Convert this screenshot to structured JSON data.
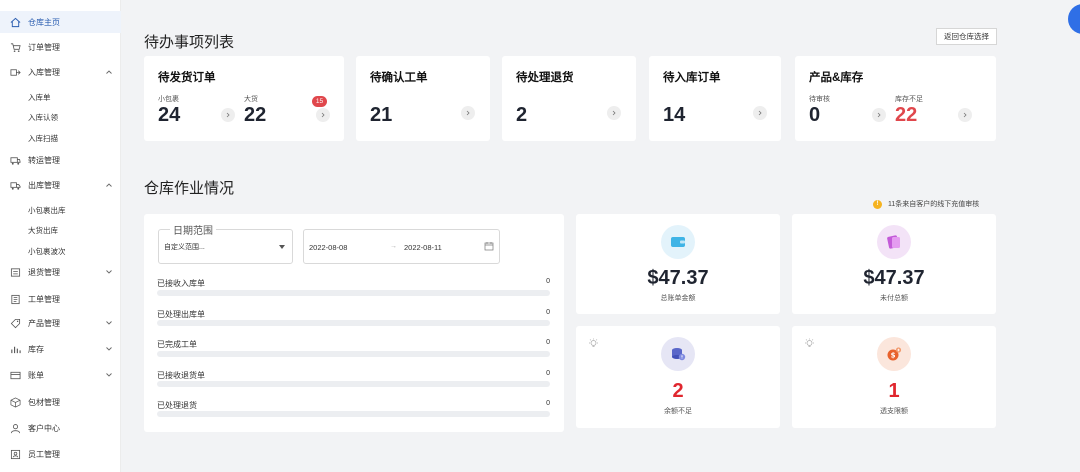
{
  "sidebar": {
    "items": [
      {
        "label": "仓库主页",
        "icon": "home-icon",
        "active": true
      },
      {
        "label": "订单管理",
        "icon": "cart-icon"
      },
      {
        "label": "入库管理",
        "icon": "inbound-icon",
        "expanded": true,
        "children": [
          "入库单",
          "入库认领",
          "入库扫描"
        ]
      },
      {
        "label": "转运管理",
        "icon": "transfer-icon"
      },
      {
        "label": "出库管理",
        "icon": "truck-icon",
        "expanded": true,
        "children": [
          "小包裹出库",
          "大货出库",
          "小包裹波次"
        ]
      },
      {
        "label": "退货管理",
        "icon": "return-icon"
      },
      {
        "label": "工单管理",
        "icon": "workorder-icon"
      },
      {
        "label": "产品管理",
        "icon": "tag-icon"
      },
      {
        "label": "库存",
        "icon": "stock-icon"
      },
      {
        "label": "账单",
        "icon": "bill-icon"
      },
      {
        "label": "包材管理",
        "icon": "box-icon"
      },
      {
        "label": "客户中心",
        "icon": "user-icon"
      },
      {
        "label": "员工管理",
        "icon": "staff-icon"
      }
    ]
  },
  "todo": {
    "title": "待办事项列表",
    "back_button": "返回仓库选择",
    "cards": {
      "ship": {
        "title": "待发货订单",
        "small_label": "小包裹",
        "small_value": "24",
        "big_label": "大货",
        "big_value": "22",
        "badge": "15"
      },
      "confirm": {
        "title": "待确认工单",
        "value": "21"
      },
      "returns": {
        "title": "待处理退货",
        "value": "2"
      },
      "inbound": {
        "title": "待入库订单",
        "value": "14"
      },
      "product": {
        "title": "产品&库存",
        "review_label": "待审核",
        "review_value": "0",
        "low_label": "库存不足",
        "low_value": "22"
      }
    }
  },
  "ops": {
    "title": "仓库作业情况",
    "notice": "11条来自客户的线下充值审核",
    "date_range": {
      "legend": "日期范围",
      "selected": "自定义范围...",
      "start": "2022-08-08",
      "separator": "→",
      "end": "2022-08-11"
    },
    "stats": [
      {
        "label": "已接收入库单",
        "value": "0"
      },
      {
        "label": "已处理出库单",
        "value": "0"
      },
      {
        "label": "已完成工单",
        "value": "0"
      },
      {
        "label": "已接收退货单",
        "value": "0"
      },
      {
        "label": "已处理退货",
        "value": "0"
      }
    ],
    "kpis": {
      "total_bill": {
        "value": "$47.37",
        "label": "总账单金额",
        "icon": "wallet-icon"
      },
      "unpaid": {
        "value": "$47.37",
        "label": "未付总额",
        "icon": "payment-icon"
      },
      "low_balance": {
        "value": "2",
        "label": "余额不足",
        "icon": "coins-alert-icon"
      },
      "overdraft": {
        "value": "1",
        "label": "透支限额",
        "icon": "money-bag-icon"
      }
    }
  },
  "colors": {
    "accent": "#2a5db0",
    "danger": "#e0474c",
    "kpi_red": "#e0262e",
    "notice": "#f5b321"
  }
}
